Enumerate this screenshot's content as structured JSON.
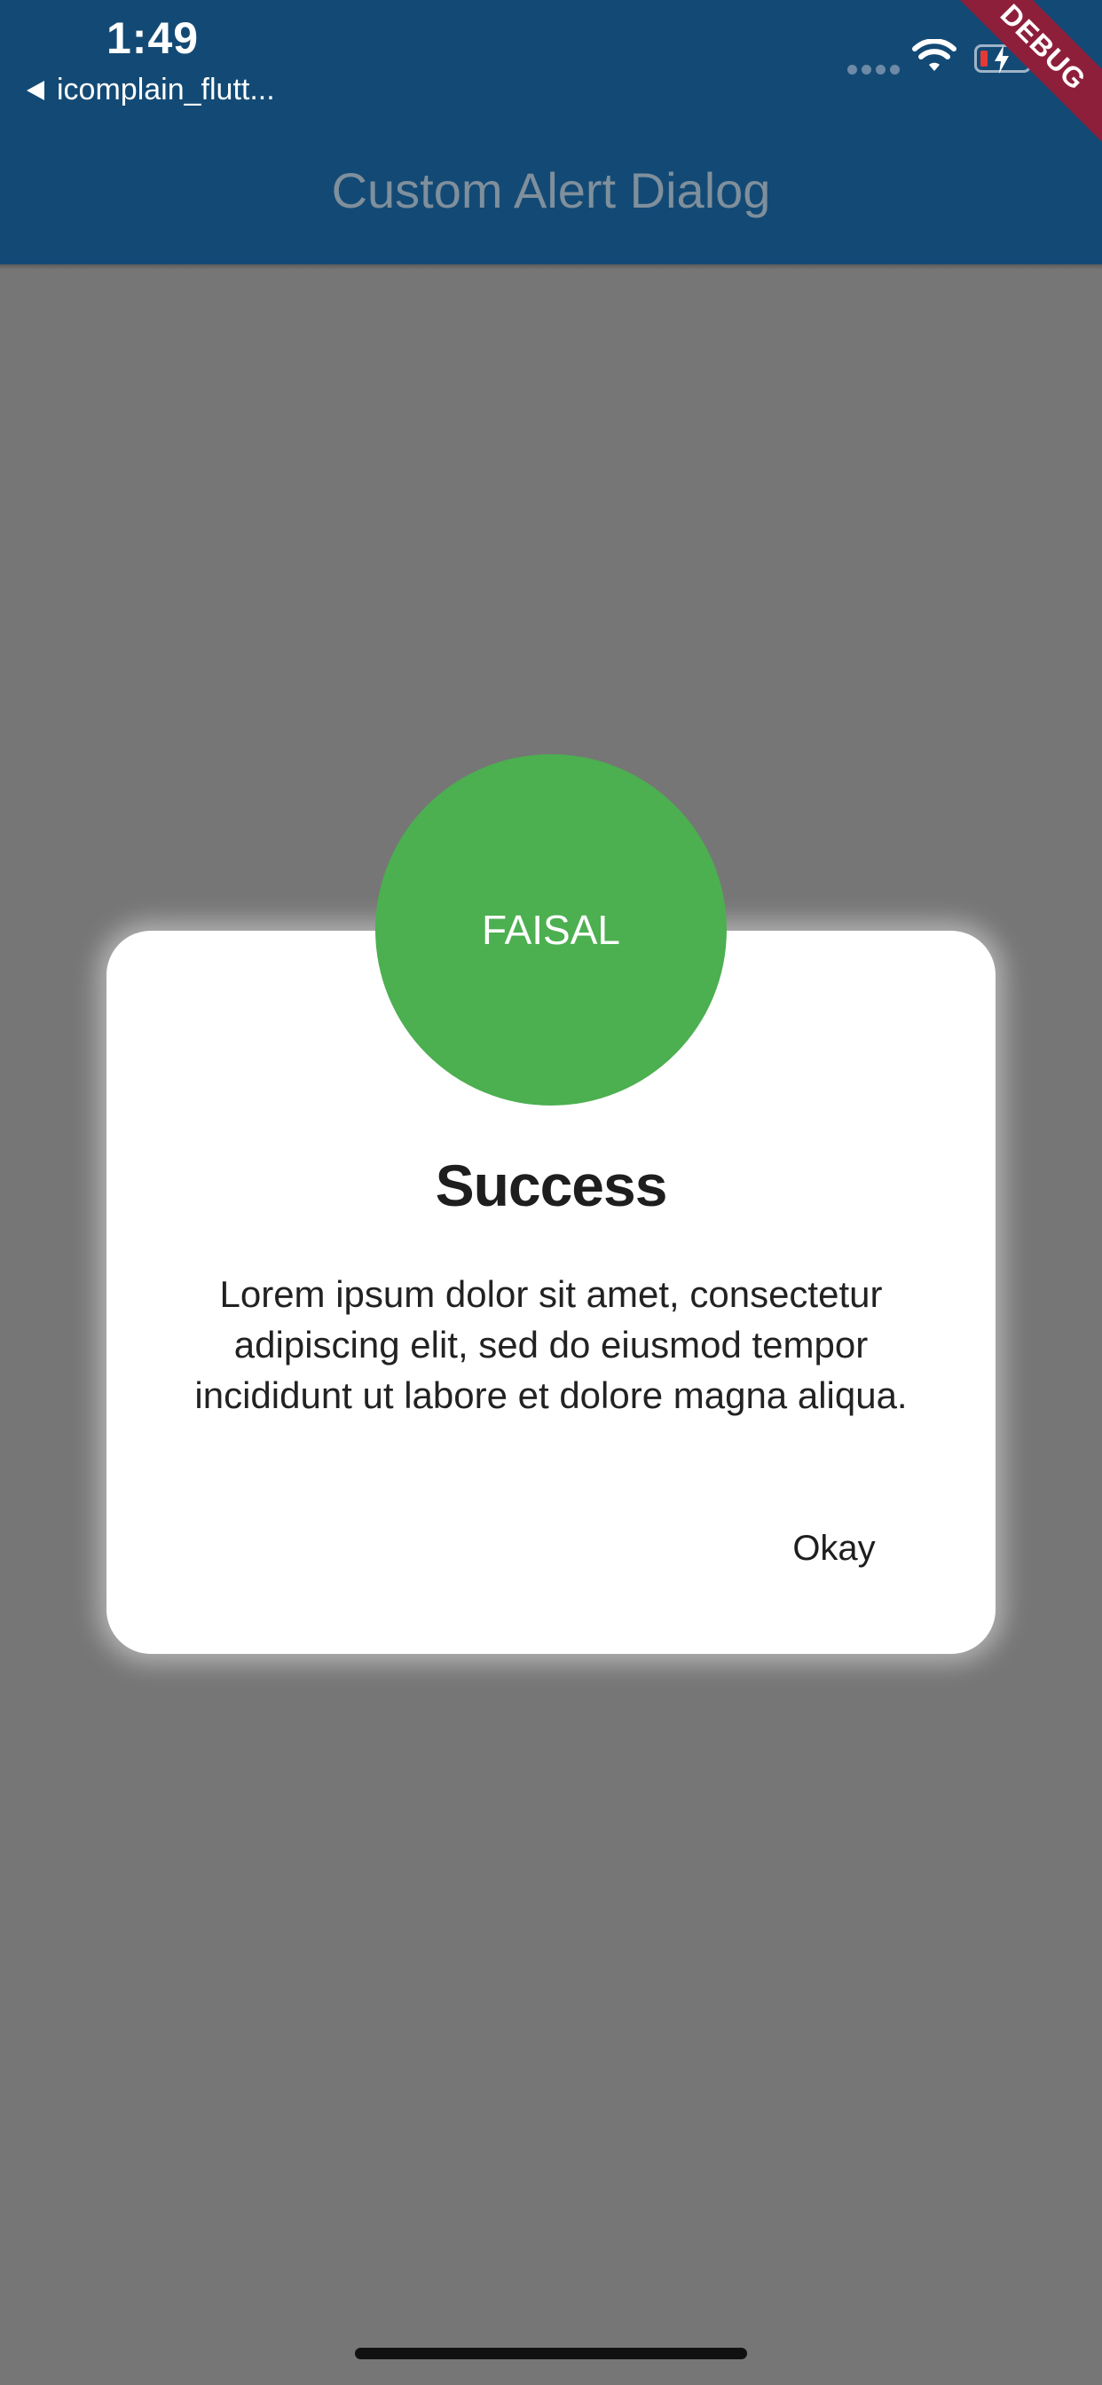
{
  "status_bar": {
    "time": "1:49",
    "back_app_label": "icomplain_flutt..."
  },
  "appbar": {
    "title": "Custom Alert Dialog",
    "debug_banner": "DEBUG",
    "background_color": "#134a75"
  },
  "dialog": {
    "avatar_text": "FAISAL",
    "avatar_color": "#4caf50",
    "title": "Success",
    "body": "Lorem ipsum dolor sit amet, consectetur adipiscing elit, sed do eiusmod tempor incididunt ut labore et dolore magna aliqua.",
    "action_label": "Okay"
  },
  "icons": [
    "signal-icon",
    "wifi-icon",
    "battery-icon",
    "back-arrow-icon"
  ]
}
